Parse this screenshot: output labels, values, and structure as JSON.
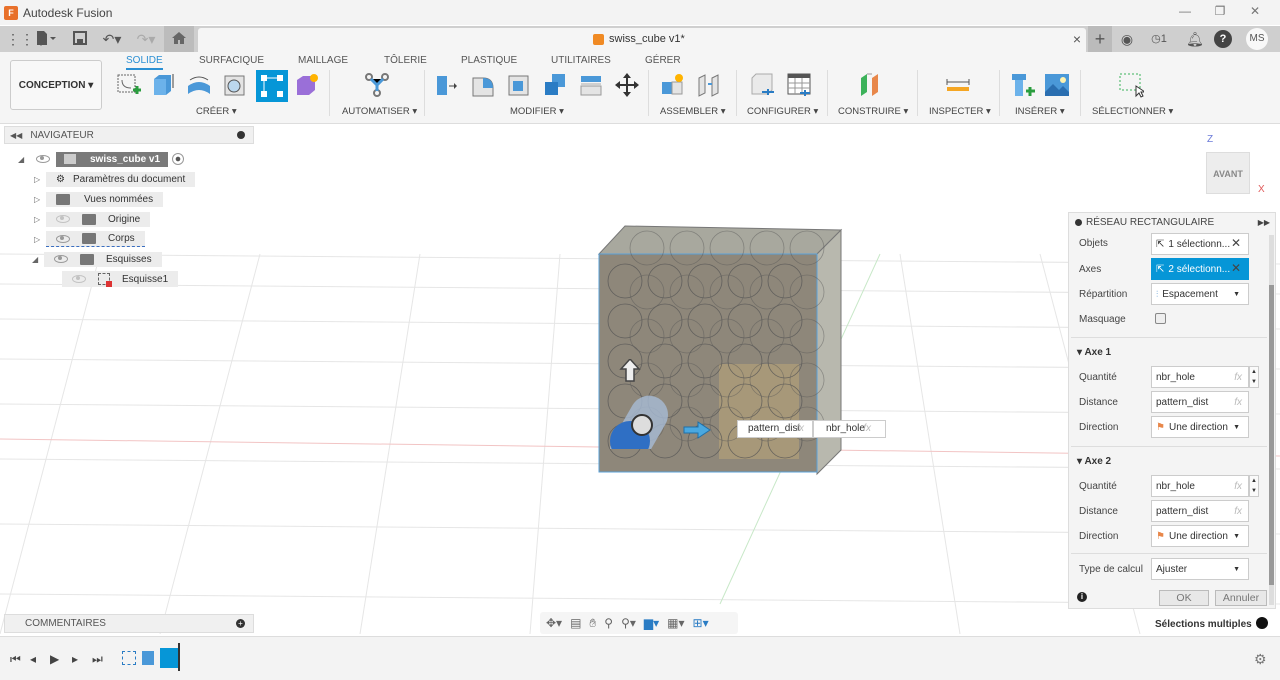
{
  "window": {
    "app_title": "Autodesk Fusion",
    "logo_letter": "F",
    "minimize": "—",
    "maximize": "❐",
    "close": "✕"
  },
  "tabbar": {
    "document_tab": "swiss_cube v1*",
    "close_tab": "×",
    "new_tab": "+",
    "job_status_count": "1",
    "user_initials": "MS",
    "icons": [
      "apps-grid-icon",
      "file-icon",
      "save-icon",
      "undo-icon",
      "redo-icon",
      "home-icon",
      "extensions-icon",
      "job-status-icon",
      "notifications-icon",
      "help-icon"
    ]
  },
  "ribbon": {
    "workspace": "CONCEPTION ▾",
    "tabs": [
      {
        "label": "SOLIDE",
        "active": true
      },
      {
        "label": "SURFACIQUE"
      },
      {
        "label": "MAILLAGE"
      },
      {
        "label": "TÔLERIE"
      },
      {
        "label": "PLASTIQUE"
      },
      {
        "label": "UTILITAIRES"
      },
      {
        "label": "GÉRER"
      }
    ],
    "groups": [
      {
        "label": "CRÉER ▾"
      },
      {
        "label": "AUTOMATISER ▾"
      },
      {
        "label": "MODIFIER ▾"
      },
      {
        "label": "ASSEMBLER ▾"
      },
      {
        "label": "CONFIGURER ▾"
      },
      {
        "label": "CONSTRUIRE ▾"
      },
      {
        "label": "INSPECTER ▾"
      },
      {
        "label": "INSÉRER ▾"
      },
      {
        "label": "SÉLECTIONNER ▾"
      }
    ]
  },
  "navigator": {
    "title": "NAVIGATEUR",
    "items": [
      {
        "label": "swiss_cube v1"
      },
      {
        "label": "Paramètres du document"
      },
      {
        "label": "Vues nommées"
      },
      {
        "label": "Origine"
      },
      {
        "label": "Corps"
      },
      {
        "label": "Esquisses"
      },
      {
        "label": "Esquisse1"
      }
    ]
  },
  "viewcube": {
    "face": "AVANT",
    "axis_z": "Z",
    "axis_x": "X"
  },
  "canvas_inputs": {
    "distance_value": "pattern_dist",
    "quantity_value": "nbr_hole",
    "fx": "fx"
  },
  "dialog": {
    "title": "RÉSEAU RECTANGULAIRE",
    "objets_label": "Objets",
    "objets_value": "1 sélectionn...",
    "axes_label": "Axes",
    "axes_value": "2 sélectionn...",
    "repartition_label": "Répartition",
    "repartition_value": "Espacement",
    "masquage_label": "Masquage",
    "axe1": {
      "title": "Axe 1",
      "quantite_label": "Quantité",
      "quantite_value": "nbr_hole",
      "distance_label": "Distance",
      "distance_value": "pattern_dist",
      "direction_label": "Direction",
      "direction_value": "Une direction"
    },
    "axe2": {
      "title": "Axe 2",
      "quantite_label": "Quantité",
      "quantite_value": "nbr_hole",
      "distance_label": "Distance",
      "distance_value": "pattern_dist",
      "direction_label": "Direction",
      "direction_value": "Une direction"
    },
    "type_calcul_label": "Type de calcul",
    "type_calcul_value": "Ajuster",
    "ok": "OK",
    "cancel": "Annuler",
    "fx": "fx",
    "clear": "✕"
  },
  "status": {
    "multi_select": "Sélections multiples"
  },
  "comments": {
    "title": "COMMENTAIRES"
  },
  "colors": {
    "accent": "#0696d7",
    "tab_active": "#2a8fd3",
    "panel_bg": "#f4f4f4"
  }
}
